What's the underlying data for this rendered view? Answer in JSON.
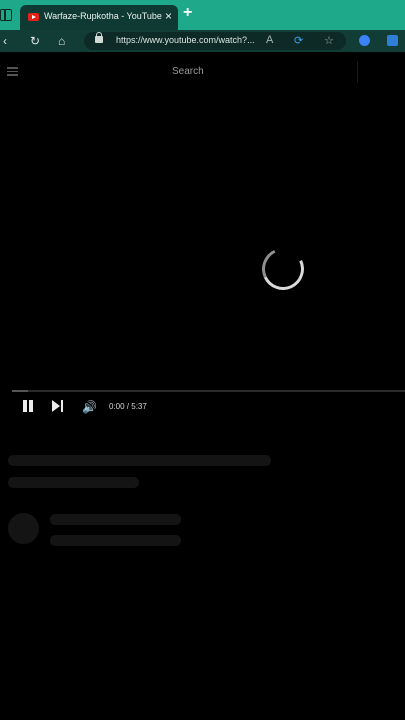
{
  "browser": {
    "tab": {
      "title": "Warfaze-Rupkotha - YouTube",
      "close": "×",
      "favicon": "youtube-icon"
    },
    "new_tab": "+",
    "address": "https://www.youtube.com/watch?...",
    "colors": {
      "tabbar": "#1ea98a",
      "navbar": "#123d37",
      "active_tab": "#0f3a33"
    }
  },
  "youtube": {
    "search_placeholder": "Search",
    "player": {
      "state": "loading",
      "time": "0:00 / 5:37",
      "progress": 0.04,
      "controls": [
        "pause-icon",
        "next-icon",
        "volume-icon"
      ]
    }
  }
}
